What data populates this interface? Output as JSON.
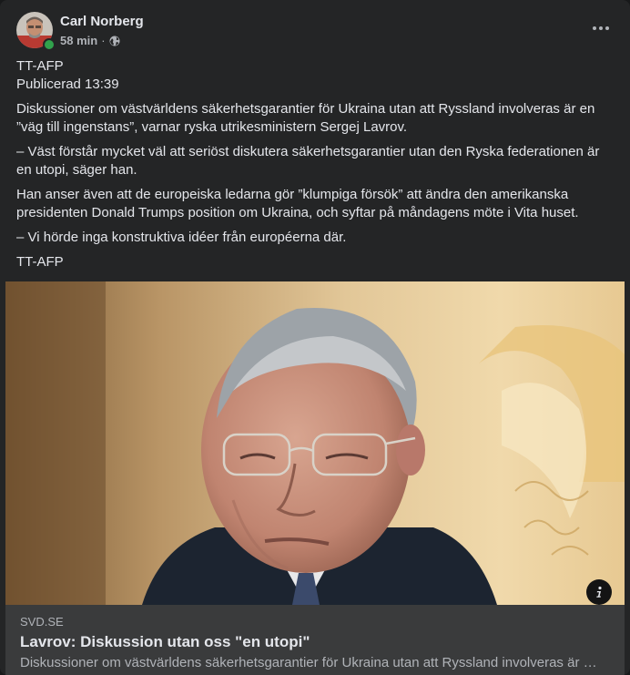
{
  "post": {
    "author": "Carl Norberg",
    "time": "58 min",
    "separator": "·",
    "privacy_icon": "globe-icon",
    "paragraphs": [
      "Diskussioner om västvärldens säkerhetsgarantier för Ukraina utan att Ryssland involveras är en ”väg till ingenstans”, varnar ryska utrikesministern Sergej Lavrov.",
      "– Väst förstår mycket väl att seriöst diskutera säkerhetsgarantier utan den Ryska federationen är en utopi, säger han.",
      "Han anser även att de europeiska ledarna gör ”klumpiga försök” att ändra den amerikanska presidenten Donald Trumps position om Ukraina, och syftar på måndagens möte i Vita huset.",
      "– Vi hörde inga konstruktiva idéer från européerna där.",
      "TT-AFP"
    ],
    "source_line": "TT-AFP",
    "published": "Publicerad 13:39"
  },
  "link_preview": {
    "domain": "SVD.SE",
    "title": "Lavrov: Diskussion utan oss \"en utopi\"",
    "description": "Diskussioner om västvärldens säkerhetsgarantier för Ukraina utan att Ryssland involveras är en ”väg till ingenstans”, varnar ryska utrikesministern Sergej Lavrov."
  },
  "colors": {
    "card_bg": "#242526",
    "link_bg": "#3a3b3c",
    "text_primary": "#e4e6eb",
    "text_secondary": "#b0b3b8",
    "online": "#31a24c"
  }
}
